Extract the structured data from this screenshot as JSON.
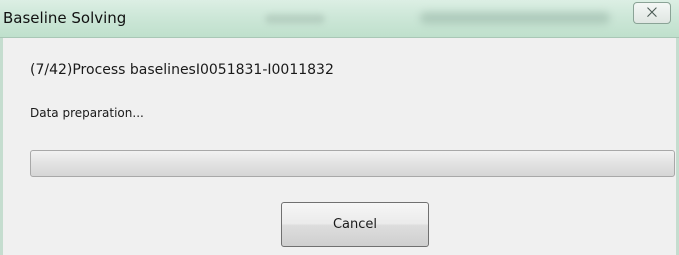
{
  "window": {
    "title": "Baseline Solving",
    "close_label": "⨉"
  },
  "main": {
    "process_text": "(7/42)Process baselinesI0051831-I0011832",
    "status_text": "Data preparation...",
    "progress_fraction": 0,
    "cancel_label": "Cancel"
  },
  "colors": {
    "titlebar": "#cde7d8",
    "client_background": "#f0f0f0",
    "progress_fill": "#39b233"
  }
}
